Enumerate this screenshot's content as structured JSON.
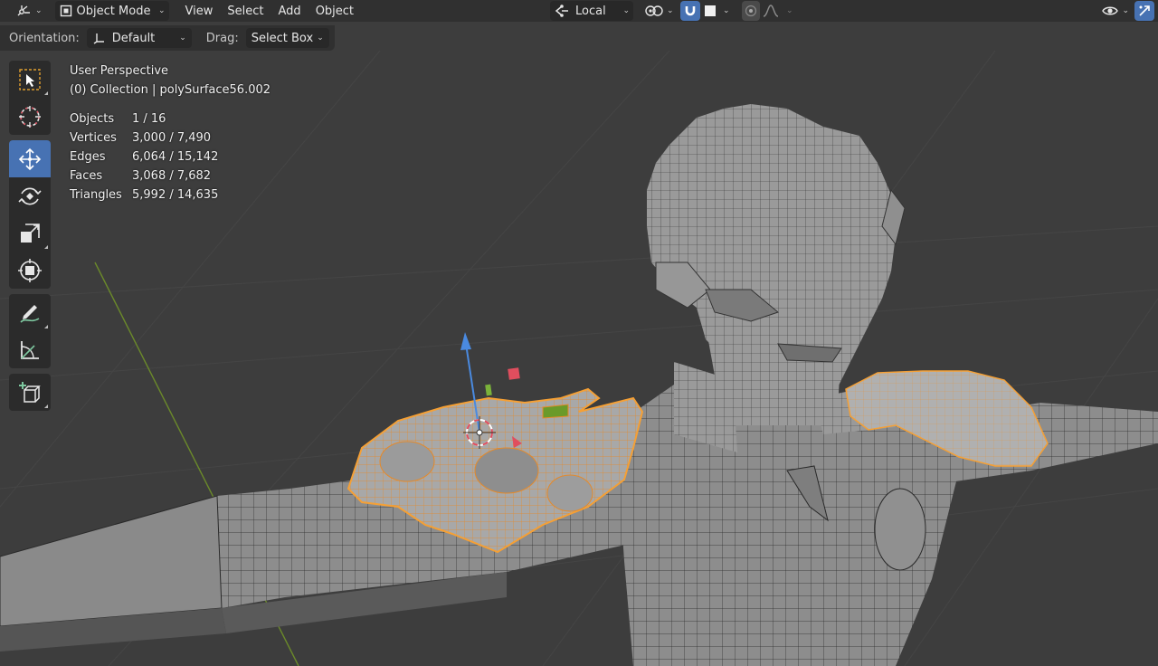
{
  "header": {
    "editor_type_icon": "editor-type-icon",
    "mode_label": "Object Mode",
    "menus": [
      "View",
      "Select",
      "Add",
      "Object"
    ],
    "pivot_label": "Local",
    "snap_icon": "magnet-icon",
    "proportional_icon": "proportional-edit-icon"
  },
  "tool_header": {
    "orientation_label": "Orientation:",
    "orientation_value": "Default",
    "drag_label": "Drag:",
    "drag_value": "Select Box"
  },
  "overlay": {
    "view_name": "User Perspective",
    "collection_info": "(0) Collection | polySurface56.002"
  },
  "stats": [
    {
      "key": "Objects",
      "value": "1 / 16"
    },
    {
      "key": "Vertices",
      "value": "3,000 / 7,490"
    },
    {
      "key": "Edges",
      "value": "6,064 / 15,142"
    },
    {
      "key": "Faces",
      "value": "3,068 / 7,682"
    },
    {
      "key": "Triangles",
      "value": "5,992 / 14,635"
    }
  ],
  "toolbar": {
    "tools": [
      "select-box",
      "cursor",
      "move",
      "rotate",
      "scale",
      "transform",
      "annotate",
      "measure",
      "add-cube"
    ],
    "active_tool": "move"
  },
  "colors": {
    "background": "#3d3d3d",
    "header": "#303030",
    "accent": "#4772b3",
    "selection": "#f5a035",
    "mesh": "#8c8c8c"
  }
}
